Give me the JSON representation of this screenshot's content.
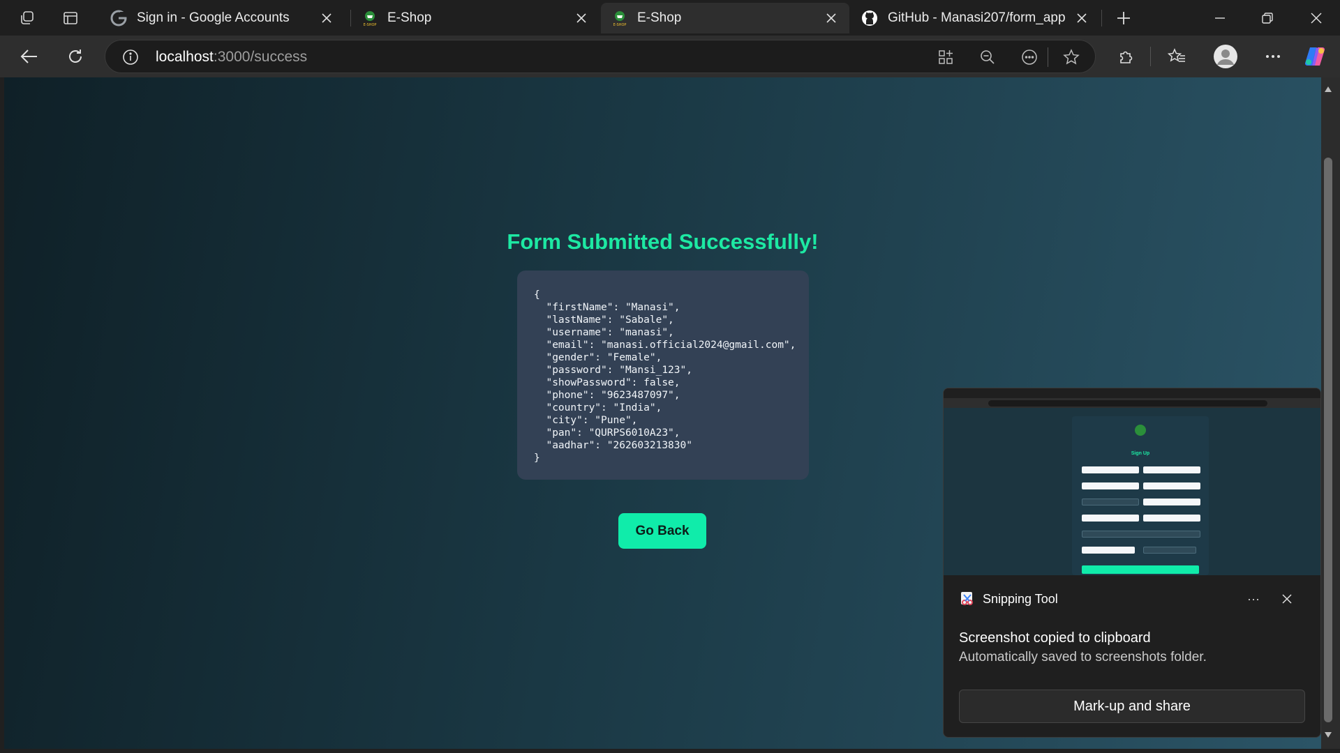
{
  "browser": {
    "tabs": [
      {
        "title": "Sign in - Google Accounts",
        "icon": "google-g-icon",
        "active": false
      },
      {
        "title": "E-Shop",
        "icon": "eshop-favicon",
        "active": false
      },
      {
        "title": "E-Shop",
        "icon": "eshop-favicon",
        "active": true
      },
      {
        "title": "GitHub - Manasi207/form_app",
        "icon": "github-icon",
        "active": false
      }
    ],
    "address": {
      "host": "localhost",
      "path": ":3000/success"
    }
  },
  "page": {
    "title": "Form Submitted Successfully!",
    "json_text": "{\n  \"firstName\": \"Manasi\",\n  \"lastName\": \"Sabale\",\n  \"username\": \"manasi\",\n  \"email\": \"manasi.official2024@gmail.com\",\n  \"gender\": \"Female\",\n  \"password\": \"Mansi_123\",\n  \"showPassword\": false,\n  \"phone\": \"9623487097\",\n  \"country\": \"India\",\n  \"city\": \"Pune\",\n  \"pan\": \"QURPS6010A23\",\n  \"aadhar\": \"262603213830\"\n}",
    "go_back_label": "Go Back",
    "accent_color": "#1de9a3",
    "button_color": "#10ecaa"
  },
  "toast": {
    "app_name": "Snipping Tool",
    "more_label": "···",
    "message": "Screenshot copied to clipboard",
    "sub_message": "Automatically saved to screenshots folder.",
    "action_label": "Mark-up and share",
    "preview": {
      "title": "Sign Up"
    }
  }
}
